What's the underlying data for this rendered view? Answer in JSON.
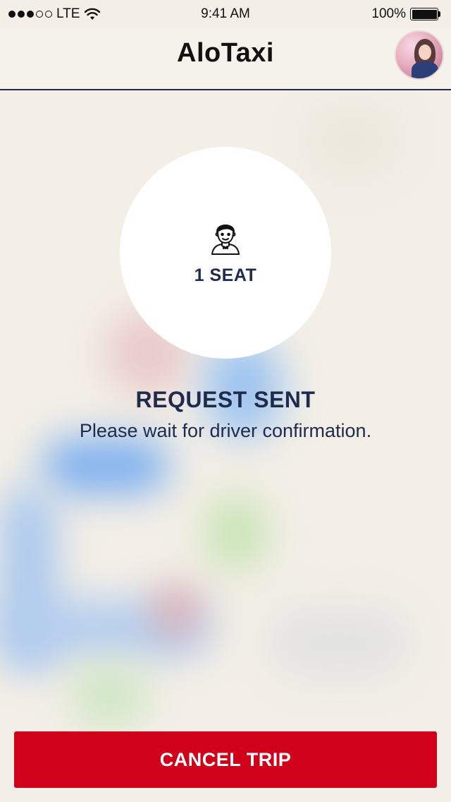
{
  "status_bar": {
    "carrier": "LTE",
    "time": "9:41 AM",
    "battery": "100%",
    "signal_strength": 3,
    "signal_max": 5
  },
  "header": {
    "title": "AloTaxi",
    "avatar_icon": "user-avatar"
  },
  "seat": {
    "icon": "driver-icon",
    "label": "1 SEAT"
  },
  "request": {
    "title": "REQUEST SENT",
    "subtitle": "Please wait for driver confirmation."
  },
  "actions": {
    "cancel_label": "CANCEL TRIP"
  },
  "colors": {
    "accent": "#d0021b",
    "text": "#1f2b4d",
    "background": "#f3efe7"
  }
}
